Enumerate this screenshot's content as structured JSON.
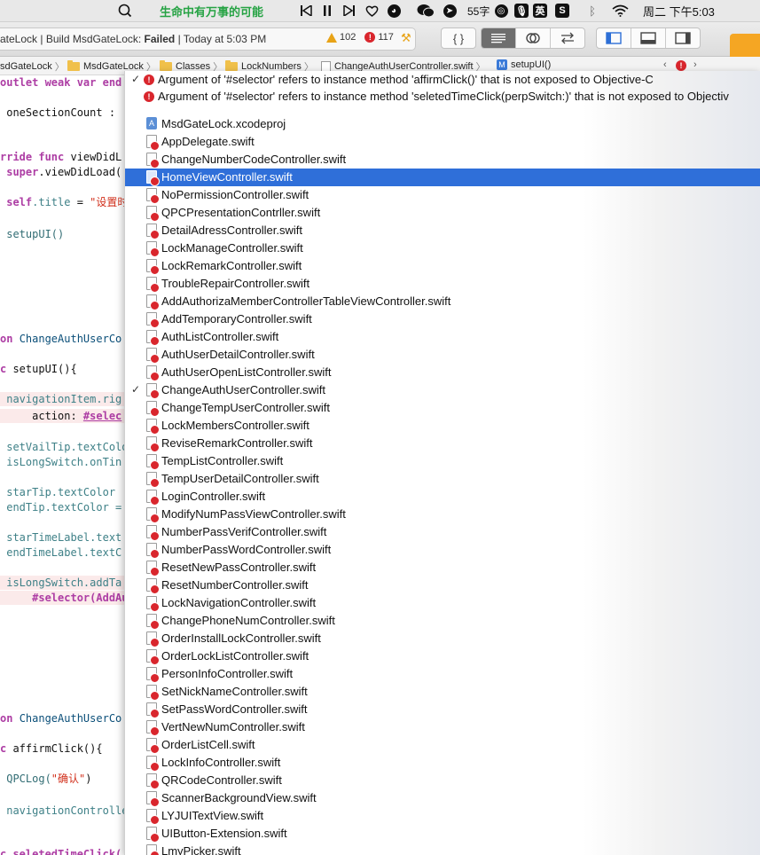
{
  "menubar": {
    "lyric_text": "生命中有万事的可能",
    "word_count": "55字",
    "input_method": "英",
    "datetime": "周二 下午5:03"
  },
  "toolbar": {
    "activity_prefix": "ateLock | Build MsdGateLock: ",
    "activity_status": "Failed",
    "activity_time": " | Today at 5:03 PM",
    "warning_count": "102",
    "error_count": "117",
    "code_snippet_glyph": "{ }"
  },
  "jumpbar": {
    "crumbs": [
      "sdGateLock",
      "MsdGateLock",
      "Classes",
      "LockNumbers",
      "ChangeAuthUserController.swift",
      "setupUI()"
    ],
    "method_badge": "M"
  },
  "issues": [
    "Argument of '#selector' refers to instance method 'affirmClick()' that is not exposed to Objective-C",
    "Argument of '#selector' refers to instance method 'seletedTimeClick(perpSwitch:)' that is not exposed to Objectiv"
  ],
  "files": [
    {
      "name": "MsdGateLock.xcodeproj",
      "kind": "project"
    },
    {
      "name": "AppDelegate.swift",
      "kind": "swift"
    },
    {
      "name": "ChangeNumberCodeController.swift",
      "kind": "swift"
    },
    {
      "name": "HomeViewController.swift",
      "kind": "swift",
      "selected": true
    },
    {
      "name": "NoPermissionController.swift",
      "kind": "swift"
    },
    {
      "name": "QPCPresentationContrller.swift",
      "kind": "swift"
    },
    {
      "name": "DetailAdressController.swift",
      "kind": "swift"
    },
    {
      "name": "LockManageController.swift",
      "kind": "swift"
    },
    {
      "name": "LockRemarkController.swift",
      "kind": "swift"
    },
    {
      "name": "TroubleRepairController.swift",
      "kind": "swift"
    },
    {
      "name": "AddAuthorizaMemberControllerTableViewController.swift",
      "kind": "swift"
    },
    {
      "name": "AddTemporaryController.swift",
      "kind": "swift"
    },
    {
      "name": "AuthListController.swift",
      "kind": "swift"
    },
    {
      "name": "AuthUserDetailController.swift",
      "kind": "swift"
    },
    {
      "name": "AuthUserOpenListController.swift",
      "kind": "swift"
    },
    {
      "name": "ChangeAuthUserController.swift",
      "kind": "swift",
      "checked": true
    },
    {
      "name": "ChangeTempUserController.swift",
      "kind": "swift"
    },
    {
      "name": "LockMembersController.swift",
      "kind": "swift"
    },
    {
      "name": "ReviseRemarkController.swift",
      "kind": "swift"
    },
    {
      "name": "TempListController.swift",
      "kind": "swift"
    },
    {
      "name": "TempUserDetailController.swift",
      "kind": "swift"
    },
    {
      "name": "LoginController.swift",
      "kind": "swift"
    },
    {
      "name": "ModifyNumPassViewController.swift",
      "kind": "swift"
    },
    {
      "name": "NumberPassVerifController.swift",
      "kind": "swift"
    },
    {
      "name": "NumberPassWordController.swift",
      "kind": "swift"
    },
    {
      "name": "ResetNewPassController.swift",
      "kind": "swift"
    },
    {
      "name": "ResetNumberController.swift",
      "kind": "swift"
    },
    {
      "name": "LockNavigationController.swift",
      "kind": "swift"
    },
    {
      "name": "ChangePhoneNumController.swift",
      "kind": "swift"
    },
    {
      "name": "OrderInstallLockController.swift",
      "kind": "swift"
    },
    {
      "name": "OrderLockListController.swift",
      "kind": "swift"
    },
    {
      "name": "PersonInfoController.swift",
      "kind": "swift"
    },
    {
      "name": "SetNickNameController.swift",
      "kind": "swift"
    },
    {
      "name": "SetPassWordController.swift",
      "kind": "swift"
    },
    {
      "name": "VertNewNumController.swift",
      "kind": "swift"
    },
    {
      "name": "OrderListCell.swift",
      "kind": "swift"
    },
    {
      "name": "LockInfoController.swift",
      "kind": "swift"
    },
    {
      "name": "QRCodeController.swift",
      "kind": "swift"
    },
    {
      "name": "ScannerBackgroundView.swift",
      "kind": "swift"
    },
    {
      "name": "LYJUITextView.swift",
      "kind": "swift"
    },
    {
      "name": "UIButton-Extension.swift",
      "kind": "swift"
    },
    {
      "name": "LmyPicker.swift",
      "kind": "swift"
    }
  ],
  "code": {
    "l1": "outlet weak var end",
    "l2": " oneSectionCount : ",
    "l3a": "rride func ",
    "l3b": "viewDidL",
    "l4a": " super",
    "l4b": ".viewDidLoad(",
    "l5a": " self",
    "l5b": ".title",
    "l5c": " = ",
    "l5d": "\"设置时",
    "l6": " setupUI()",
    "l7a": "on ",
    "l7b": "ChangeAuthUserCo",
    "l8a": "c ",
    "l8b": "setupUI(){",
    "l9": " navigationItem.rig",
    "l10a": "     action: ",
    "l10b": "#selec",
    "l11": " setVailTip.textColo",
    "l12": " isLongSwitch.onTin",
    "l13": " starTip.textColor ",
    "l14": " endTip.textColor =",
    "l15": " starTimeLabel.text",
    "l16": " endTimeLabel.textC",
    "l17": " isLongSwitch.addTa",
    "l18": "     #selector(AddAu",
    "l19a": "on ",
    "l19b": "ChangeAuthUserCo",
    "l20a": "c ",
    "l20b": "affirmClick(){",
    "l21a": " QPCLog(",
    "l21b": "\"确认\"",
    "l21c": ")",
    "l22": " navigationControlle",
    "l23": "c seletedTimeClick("
  }
}
